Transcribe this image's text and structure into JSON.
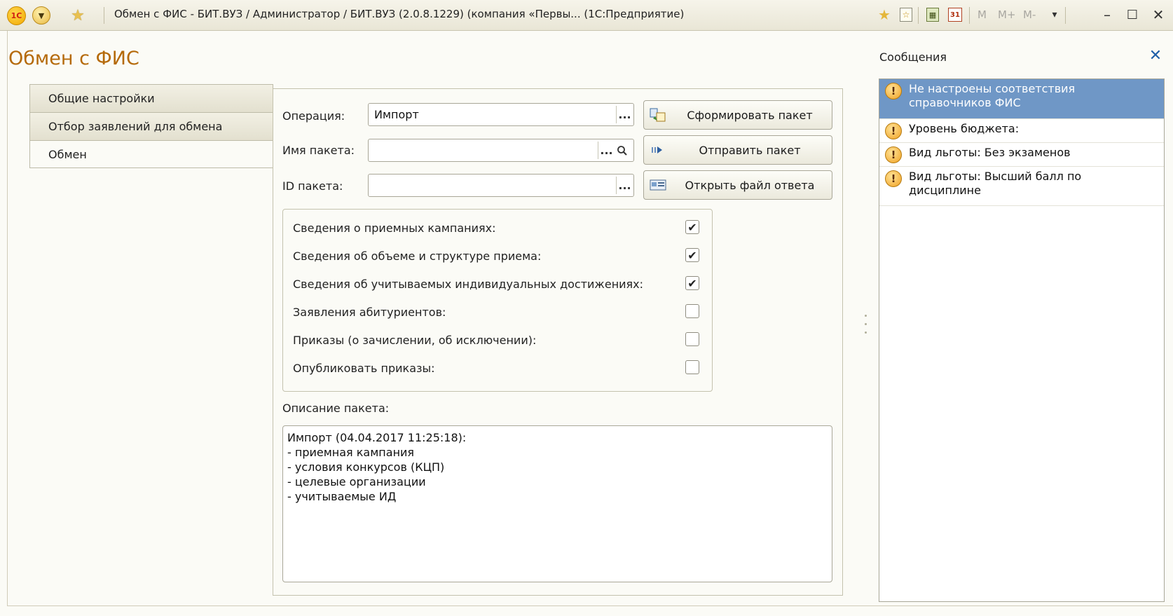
{
  "titlebar": {
    "logo": "1С",
    "title": "Обмен с ФИС - БИТ.ВУЗ / Администратор / БИТ.ВУЗ (2.0.8.1229) (компания «Первы... (1С:Предприятие)",
    "memory": [
      "M",
      "M+",
      "M-"
    ],
    "icons": [
      "1c-logo-icon",
      "main-menu-icon",
      "favorite-star-icon",
      "favorites-icon",
      "history-icon",
      "calculator-icon",
      "calendar-icon",
      "minimize-icon",
      "maximize-icon",
      "close-icon"
    ],
    "calendar_day": "31"
  },
  "form": {
    "title": "Обмен с ФИС",
    "tabs": [
      {
        "label": "Общие настройки"
      },
      {
        "label": "Отбор заявлений для обмена"
      },
      {
        "label": "Обмен",
        "active": true
      }
    ],
    "operation": {
      "label": "Операция:",
      "value": "Импорт"
    },
    "package_name": {
      "label": "Имя пакета:",
      "value": ""
    },
    "package_id": {
      "label": "ID пакета:",
      "value": ""
    },
    "ellipsis": "...",
    "buttons": {
      "build": "Сформировать пакет",
      "send": "Отправить пакет",
      "open_response": "Открыть файл ответа"
    },
    "checks": [
      {
        "label": "Сведения о приемных кампаниях:",
        "checked": true
      },
      {
        "label": "Сведения об объеме и структуре приема:",
        "checked": true
      },
      {
        "label": "Сведения об учитываемых индивидуальных достижениях:",
        "checked": true
      },
      {
        "label": "Заявления абитуриентов:",
        "checked": false
      },
      {
        "label": "Приказы (о зачислении, об исключении):",
        "checked": false
      },
      {
        "label": "Опубликовать приказы:",
        "checked": false
      }
    ],
    "check_mark": "✔",
    "description": {
      "label": "Описание пакета:",
      "lines": [
        "Импорт (04.04.2017 11:25:18):",
        " - приемная кампания",
        " - условия конкурсов (КЦП)",
        " - целевые организации",
        " - учитываемые ИД"
      ]
    }
  },
  "messages": {
    "title": "Сообщения",
    "close": "✕",
    "warn_glyph": "!",
    "items": [
      {
        "text": "Не настроены соответствия справочников ФИС",
        "selected": true
      },
      {
        "text": "Уровень бюджета:",
        "selected": false
      },
      {
        "text": "Вид льготы: Без экзаменов",
        "selected": false
      },
      {
        "text": "Вид льготы: Высший балл по дисциплине",
        "selected": false
      }
    ]
  },
  "colors": {
    "title_orange": "#b56a0a",
    "selected_row": "#6f97c6",
    "close_blue": "#1f5fa8"
  }
}
